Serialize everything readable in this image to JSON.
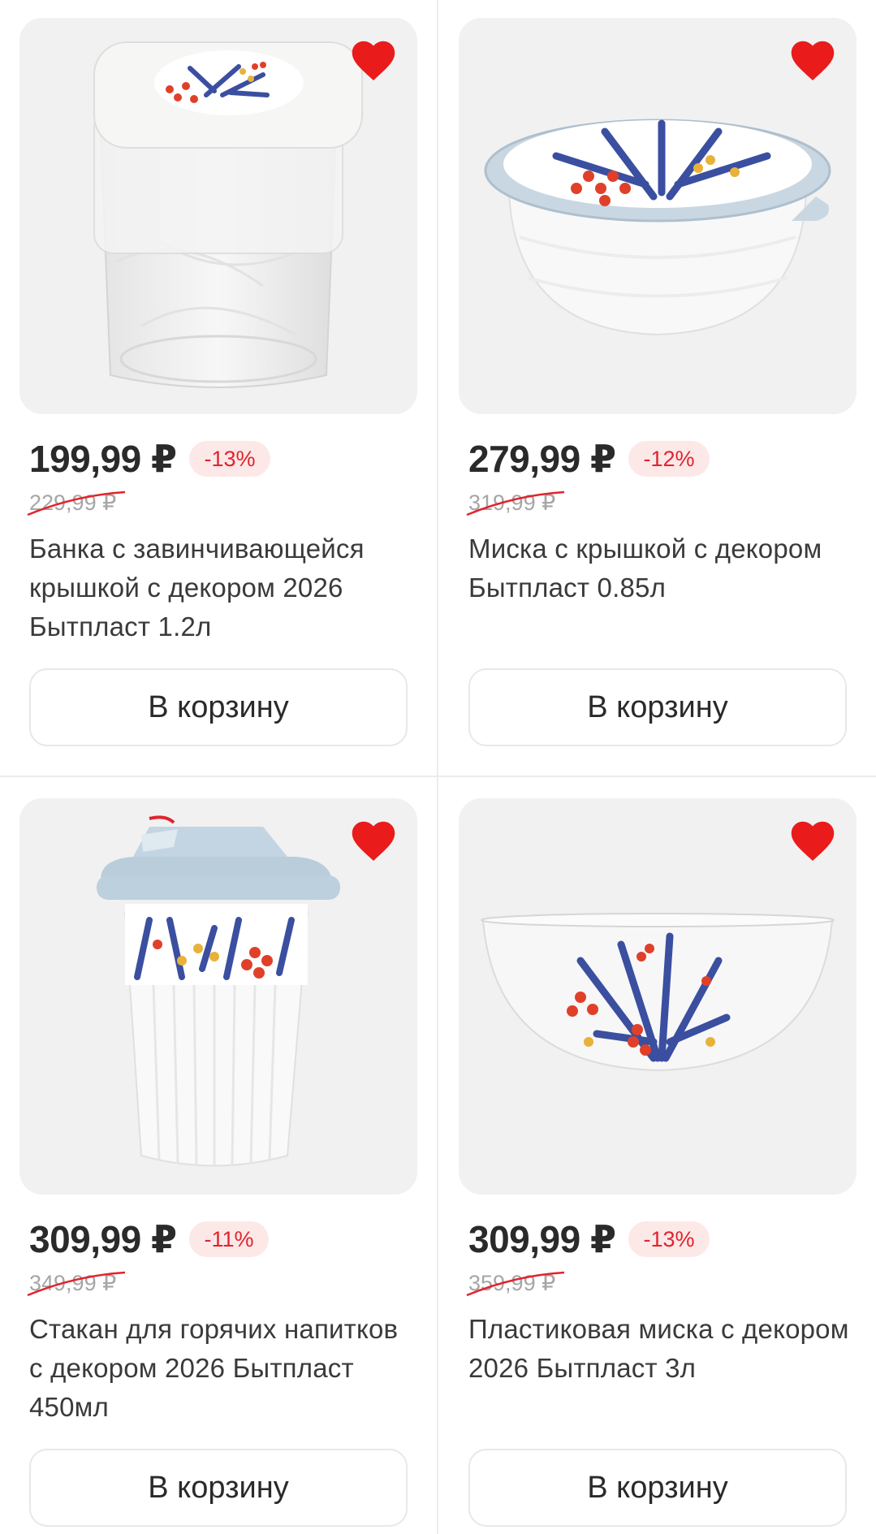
{
  "accent_color": "#e0242c",
  "products": [
    {
      "name": "Банка с завинчивающейся крышкой с декором 2026 Бытпласт 1.2л",
      "price": "199,99 ₽",
      "discount": "-13%",
      "old_price": "229,99 ₽",
      "favorite": true,
      "image": "jar-with-floral-lid",
      "button_label": "В корзину"
    },
    {
      "name": "Миска с крышкой с декором Бытпласт 0.85л",
      "price": "279,99 ₽",
      "discount": "-12%",
      "old_price": "319,99 ₽",
      "favorite": true,
      "image": "bowl-with-floral-lid",
      "button_label": "В корзину"
    },
    {
      "name": "Стакан для горячих напитков с декором 2026 Бытпласт 450мл",
      "price": "309,99 ₽",
      "discount": "-11%",
      "old_price": "349,99 ₽",
      "favorite": true,
      "image": "hot-drink-cup-floral",
      "button_label": "В корзину"
    },
    {
      "name": "Пластиковая миска с декором 2026 Бытпласт 3л",
      "price": "309,99 ₽",
      "discount": "-13%",
      "old_price": "359,99 ₽",
      "favorite": true,
      "image": "clear-bowl-floral",
      "button_label": "В корзину"
    }
  ]
}
